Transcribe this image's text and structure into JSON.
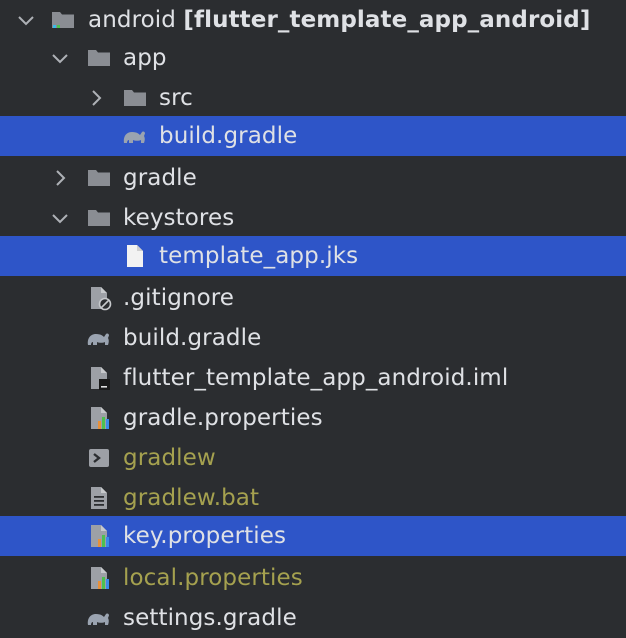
{
  "colors": {
    "background": "#2b2d30",
    "selection": "#2e55c8",
    "text": "#dfe1e5",
    "unversioned_text": "#a5a14f"
  },
  "tree": {
    "root": {
      "name": "android",
      "module": "[flutter_template_app_android]",
      "icon": "module-folder-icon"
    },
    "app": {
      "name": "app",
      "icon": "folder-icon"
    },
    "src": {
      "name": "src",
      "icon": "folder-icon"
    },
    "app_build_gradle": {
      "name": "build.gradle",
      "icon": "gradle-elephant-icon"
    },
    "gradle_dir": {
      "name": "gradle",
      "icon": "folder-icon"
    },
    "keystores": {
      "name": "keystores",
      "icon": "folder-icon"
    },
    "template_jks": {
      "name": "template_app.jks",
      "icon": "file-icon"
    },
    "gitignore": {
      "name": ".gitignore",
      "icon": "ignore-file-icon"
    },
    "build_gradle": {
      "name": "build.gradle",
      "icon": "gradle-elephant-icon"
    },
    "iml": {
      "name": "flutter_template_app_android.iml",
      "icon": "iml-file-icon"
    },
    "gradle_properties": {
      "name": "gradle.properties",
      "icon": "properties-file-icon"
    },
    "gradlew": {
      "name": "gradlew",
      "icon": "shell-script-icon"
    },
    "gradlew_bat": {
      "name": "gradlew.bat",
      "icon": "text-file-icon"
    },
    "key_properties": {
      "name": "key.properties",
      "icon": "properties-file-icon"
    },
    "local_properties": {
      "name": "local.properties",
      "icon": "properties-file-icon"
    },
    "settings_gradle": {
      "name": "settings.gradle",
      "icon": "gradle-elephant-icon"
    }
  }
}
